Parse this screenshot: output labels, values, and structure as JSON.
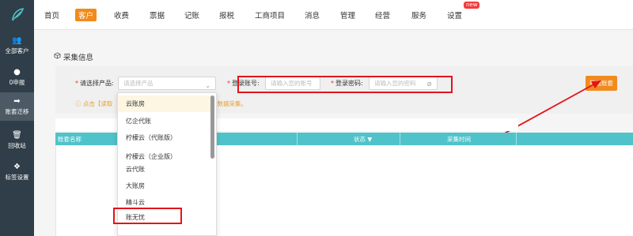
{
  "sidebar": {
    "items": [
      {
        "label": "全部客户",
        "icon": "users-icon"
      },
      {
        "label": "0申报",
        "icon": "zero-icon"
      },
      {
        "label": "账套迁移",
        "icon": "transfer-icon"
      },
      {
        "label": "回收站",
        "icon": "trash-icon"
      },
      {
        "label": "标签设置",
        "icon": "tag-icon"
      }
    ]
  },
  "topnav": {
    "items": [
      "首页",
      "客户",
      "收费",
      "票据",
      "记账",
      "报税",
      "工商项目",
      "消息",
      "管理",
      "经营",
      "服务",
      "设置"
    ],
    "active": "客户",
    "new_badge": "new"
  },
  "section": {
    "title": "采集信息"
  },
  "form": {
    "product_label": "请选择产品:",
    "product_placeholder": "请选择产品",
    "account_label": "登录账号:",
    "account_placeholder": "请输入您的账号",
    "password_label": "登录密码:",
    "password_placeholder": "请输入您的密码",
    "fetch_button": "获取账套",
    "tip_left": "ⓘ 点击【读取",
    "tip_right": "后数据采集。"
  },
  "dropdown": {
    "options": [
      "云账房",
      "亿企代账",
      "柠檬云（代账版）",
      "柠檬云（企业版）",
      "云代账",
      "大账房",
      "精斗云",
      "账无忧"
    ]
  },
  "table": {
    "headers": [
      "账套名称",
      "状态 ▼",
      "采集时间"
    ]
  },
  "colors": {
    "accent": "#f28a1c",
    "sidebar": "#2f3e48",
    "table_header": "#4fc3c9",
    "highlight": "#e3141b"
  }
}
